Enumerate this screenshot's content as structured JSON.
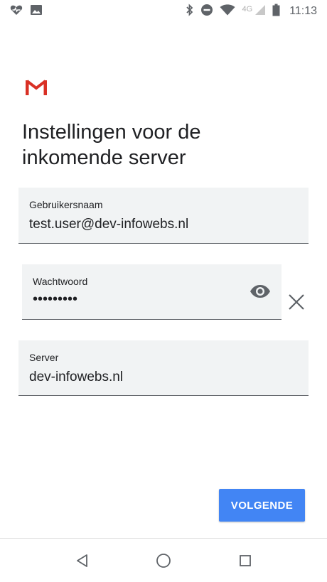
{
  "status_bar": {
    "network_label": "4G",
    "time": "11:13"
  },
  "logo": {
    "icon": "gmail-logo-icon",
    "color": "#d93025"
  },
  "page": {
    "title": "Instellingen voor de\ninkomende server"
  },
  "form": {
    "username": {
      "label": "Gebruikersnaam",
      "value": "test.user@dev-infowebs.nl"
    },
    "password": {
      "label": "Wachtwoord",
      "masked_value": "•••••••••"
    },
    "server": {
      "label": "Server",
      "value": "dev-infowebs.nl"
    }
  },
  "actions": {
    "next_label": "VOLGENDE",
    "accent": "#4285f4"
  }
}
